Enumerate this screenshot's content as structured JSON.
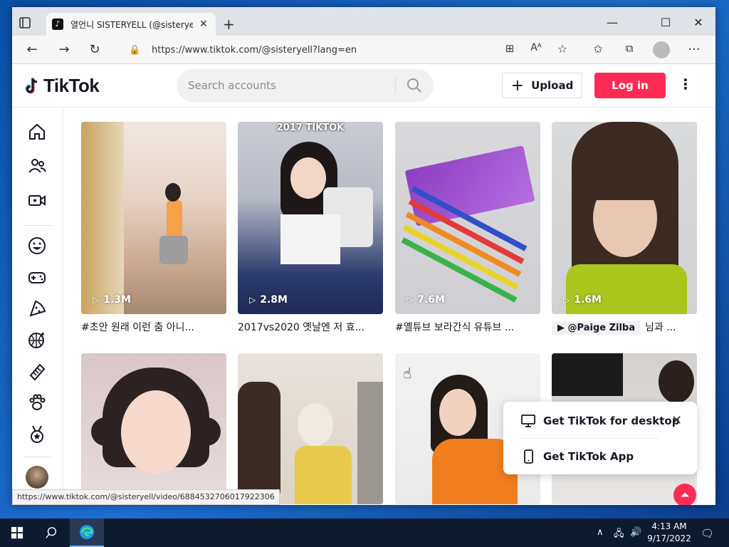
{
  "browser": {
    "tab_title": "열언니 SISTERYELL (@sisteryell) | TikTok",
    "url": "https://www.tiktok.com/@sisteryell?lang=en",
    "status_url": "https://www.tiktok.com/@sisteryell/video/6884532706017922306"
  },
  "header": {
    "logo": "TikTok",
    "search_placeholder": "Search accounts",
    "upload_label": "Upload",
    "login_label": "Log in"
  },
  "videos": [
    {
      "views": "1.3M",
      "caption": "#초안 원래 이런 춤 아니...",
      "overlay": ""
    },
    {
      "views": "2.8M",
      "caption": "2017vs2020 옛날엔 저 효...",
      "overlay": "2017 TIKTOK"
    },
    {
      "views": "7.6M",
      "caption": "#옐튜브 보라간식 유튜브 ...",
      "overlay": ""
    },
    {
      "views": "1.6M",
      "mention": "@Paige Zilba",
      "caption": "님과 ...",
      "overlay": ""
    }
  ],
  "popup": {
    "desktop_label": "Get TikTok for desktop",
    "app_label": "Get TikTok App"
  },
  "taskbar": {
    "time": "4:13 AM",
    "date": "9/17/2022"
  },
  "colors": {
    "accent": "#fe2c55"
  }
}
